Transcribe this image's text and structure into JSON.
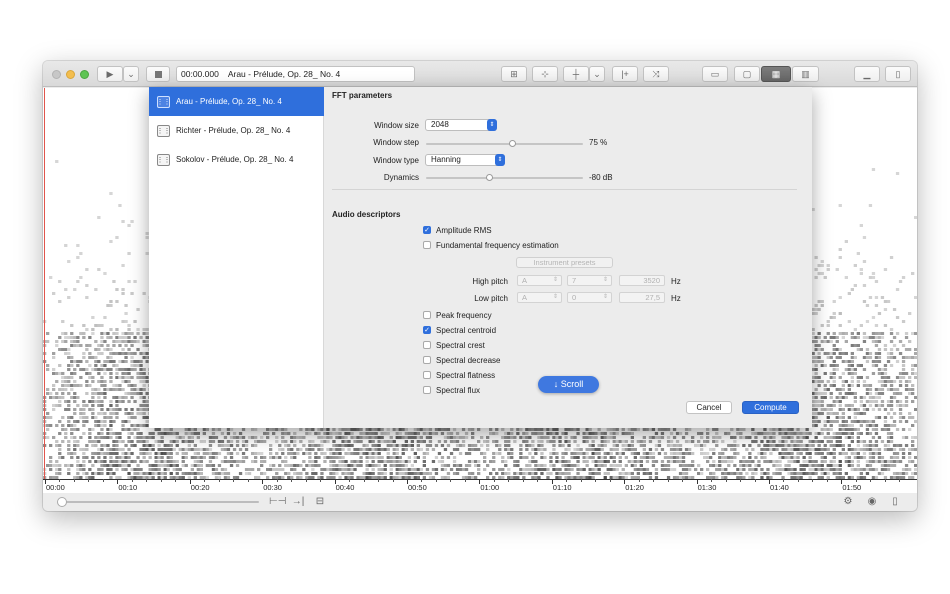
{
  "toolbar": {
    "time": "00:00.000",
    "track_title": "Arau - Prélude, Op. 28_ No. 4",
    "play_icon": "play-icon",
    "stop_icon": "stop-icon"
  },
  "timeline": {
    "labels": [
      "00:00",
      "00:10",
      "00:20",
      "00:30",
      "00:40",
      "00:50",
      "01:00",
      "01:10",
      "01:20",
      "01:30",
      "01:40",
      "01:50"
    ]
  },
  "sidebar": {
    "items": [
      {
        "label": "Arau - Prélude, Op. 28_ No. 4",
        "selected": true
      },
      {
        "label": "Richter - Prélude, Op. 28_ No. 4",
        "selected": false
      },
      {
        "label": "Sokolov - Prélude, Op. 28_ No. 4",
        "selected": false
      }
    ]
  },
  "fft": {
    "heading": "FFT parameters",
    "window_size_label": "Window size",
    "window_size_value": "2048",
    "window_step_label": "Window step",
    "window_step_value": "75 %",
    "window_step_fraction": 0.55,
    "window_type_label": "Window type",
    "window_type_value": "Hanning",
    "dynamics_label": "Dynamics",
    "dynamics_value": "-80 dB",
    "dynamics_fraction": 0.4
  },
  "descriptors": {
    "heading": "Audio descriptors",
    "amplitude_rms": {
      "label": "Amplitude RMS",
      "checked": true
    },
    "fundamental": {
      "label": "Fundamental frequency estimation",
      "checked": false
    },
    "instrument_presets": "Instrument presets",
    "high_pitch": {
      "label": "High pitch",
      "note": "A",
      "octave": "7",
      "hz": "3520",
      "unit": "Hz"
    },
    "low_pitch": {
      "label": "Low pitch",
      "note": "A",
      "octave": "0",
      "hz": "27,5",
      "unit": "Hz"
    },
    "checkboxes": [
      {
        "label": "Peak frequency",
        "checked": false
      },
      {
        "label": "Spectral centroid",
        "checked": true
      },
      {
        "label": "Spectral crest",
        "checked": false
      },
      {
        "label": "Spectral decrease",
        "checked": false
      },
      {
        "label": "Spectral flatness",
        "checked": false
      },
      {
        "label": "Spectral flux",
        "checked": false
      }
    ]
  },
  "buttons": {
    "cancel": "Cancel",
    "compute": "Compute",
    "scroll": "↓ Scroll"
  },
  "colors": {
    "accent": "#2f6fdc",
    "playhead": "#e0554c"
  }
}
